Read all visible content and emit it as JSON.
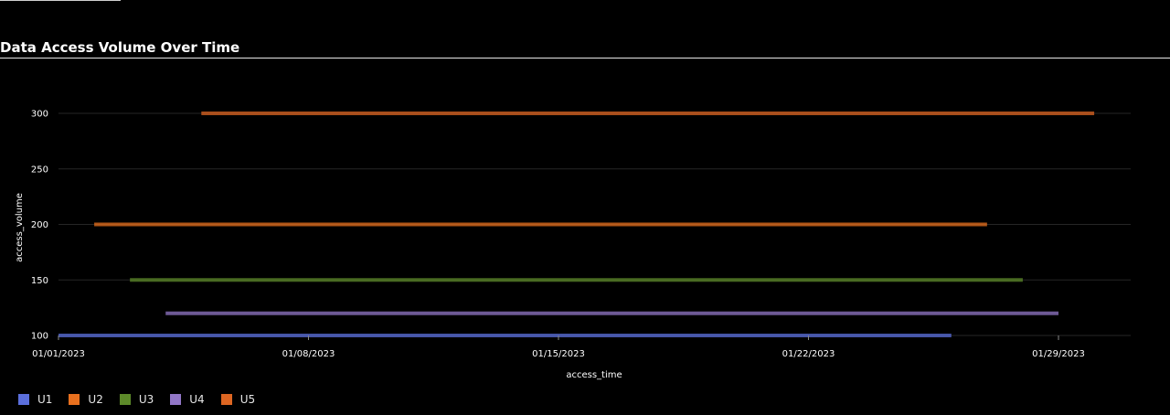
{
  "chart_data": {
    "type": "line",
    "title": "Data Access Volume Over Time",
    "xlabel": "access_time",
    "ylabel": "access_volume",
    "x_ticks": [
      "01/01/2023",
      "01/08/2023",
      "01/15/2023",
      "01/22/2023",
      "01/29/2023"
    ],
    "y_ticks": [
      100,
      150,
      200,
      250,
      300
    ],
    "xlim": [
      "2023-01-01",
      "2023-01-31"
    ],
    "ylim": [
      100,
      300
    ],
    "grid": true,
    "legend_position": "bottom-left",
    "series": [
      {
        "name": "U1",
        "color": "#5b6fdc",
        "x": [
          "2023-01-01",
          "2023-01-26"
        ],
        "y": [
          100,
          100
        ]
      },
      {
        "name": "U2",
        "color": "#e8701e",
        "x": [
          "2023-01-02",
          "2023-01-27"
        ],
        "y": [
          200,
          200
        ]
      },
      {
        "name": "U3",
        "color": "#5d8a2a",
        "x": [
          "2023-01-03",
          "2023-01-28"
        ],
        "y": [
          150,
          150
        ]
      },
      {
        "name": "U4",
        "color": "#9277c7",
        "x": [
          "2023-01-04",
          "2023-01-29"
        ],
        "y": [
          120,
          120
        ]
      },
      {
        "name": "U5",
        "color": "#dd6622",
        "x": [
          "2023-01-05",
          "2023-01-30"
        ],
        "y": [
          300,
          300
        ]
      }
    ]
  }
}
